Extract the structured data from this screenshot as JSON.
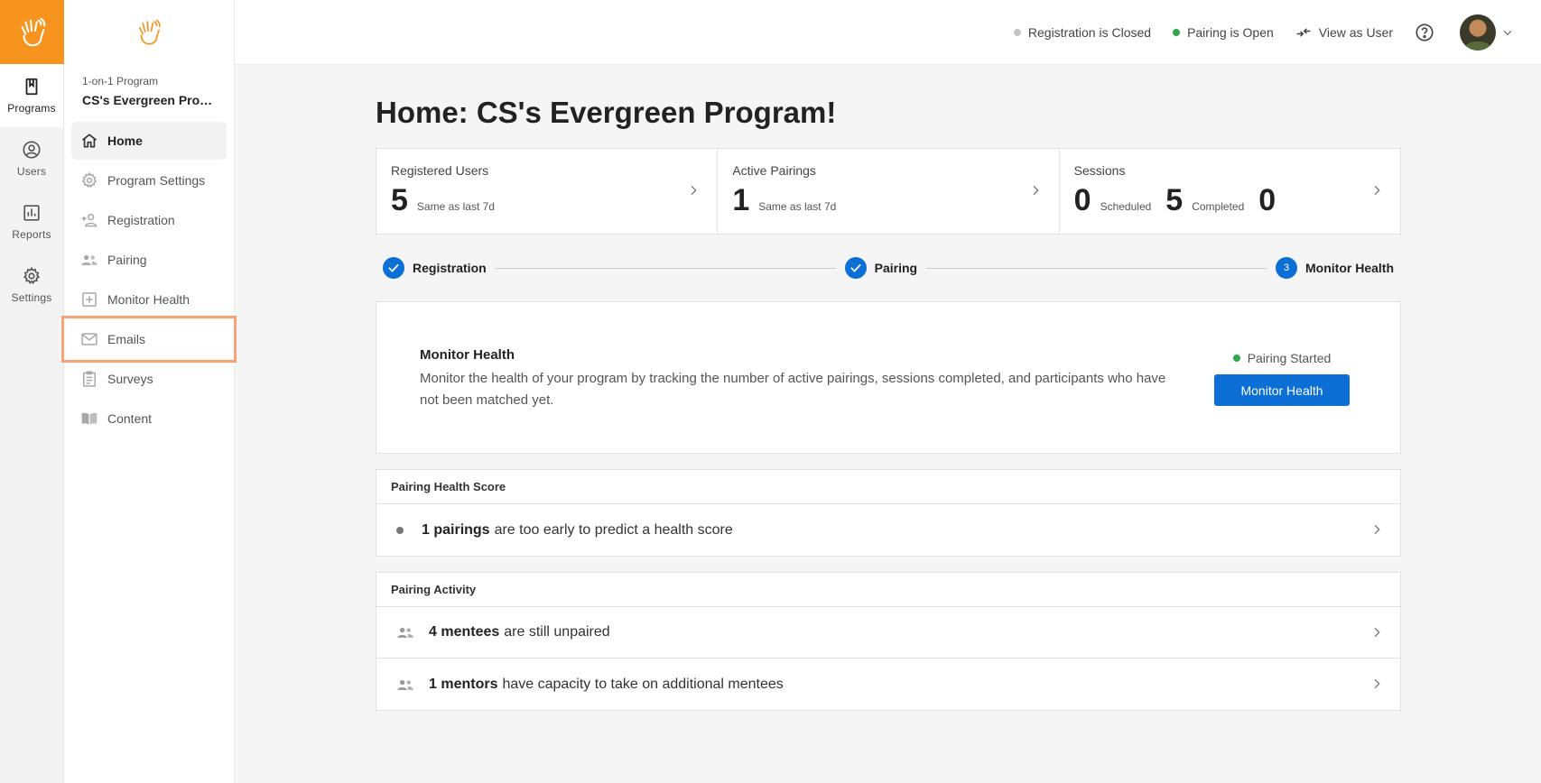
{
  "rail": {
    "items": [
      {
        "label": "Programs",
        "icon": "book-icon",
        "active": true
      },
      {
        "label": "Users",
        "icon": "user-circle-icon"
      },
      {
        "label": "Reports",
        "icon": "chart-icon"
      },
      {
        "label": "Settings",
        "icon": "gear-icon"
      }
    ]
  },
  "subnav": {
    "program_caption": "1-on-1 Program",
    "program_name": "CS's Evergreen Program!",
    "items": [
      {
        "label": "Home"
      },
      {
        "label": "Program Settings"
      },
      {
        "label": "Registration"
      },
      {
        "label": "Pairing"
      },
      {
        "label": "Monitor Health"
      },
      {
        "label": "Emails"
      },
      {
        "label": "Surveys"
      },
      {
        "label": "Content"
      }
    ]
  },
  "header": {
    "registration_status": "Registration is Closed",
    "pairing_status": "Pairing is Open",
    "view_as_user": "View as User",
    "colors": {
      "closed": "#c4c4c4",
      "open": "#2ea84a"
    }
  },
  "main": {
    "title": "Home: CS's Evergreen Program!",
    "stats": {
      "registered": {
        "label": "Registered Users",
        "value": "5",
        "note": "Same as last 7d"
      },
      "pairings": {
        "label": "Active Pairings",
        "value": "1",
        "note": "Same as last 7d"
      },
      "sessions": {
        "label": "Sessions",
        "scheduled_value": "0",
        "scheduled_label": "Scheduled",
        "completed_value": "5",
        "completed_label": "Completed",
        "extra_value": "0"
      }
    },
    "steps": [
      {
        "label": "Registration"
      },
      {
        "label": "Pairing"
      },
      {
        "label": "Monitor Health",
        "number": "3"
      }
    ],
    "monitor_card": {
      "title": "Monitor Health",
      "description": "Monitor the health of your program by tracking the number of active pairings, sessions completed, and participants who have not been matched yet.",
      "status": "Pairing Started",
      "button": "Monitor Health"
    },
    "health_section": {
      "title": "Pairing Health Score",
      "row": {
        "bold": "1 pairings",
        "text": "are too early to predict a health score"
      }
    },
    "activity_section": {
      "title": "Pairing Activity",
      "rows": [
        {
          "bold": "4 mentees",
          "text": "are still unpaired"
        },
        {
          "bold": "1 mentors",
          "text": "have capacity to take on additional mentees"
        }
      ]
    }
  }
}
